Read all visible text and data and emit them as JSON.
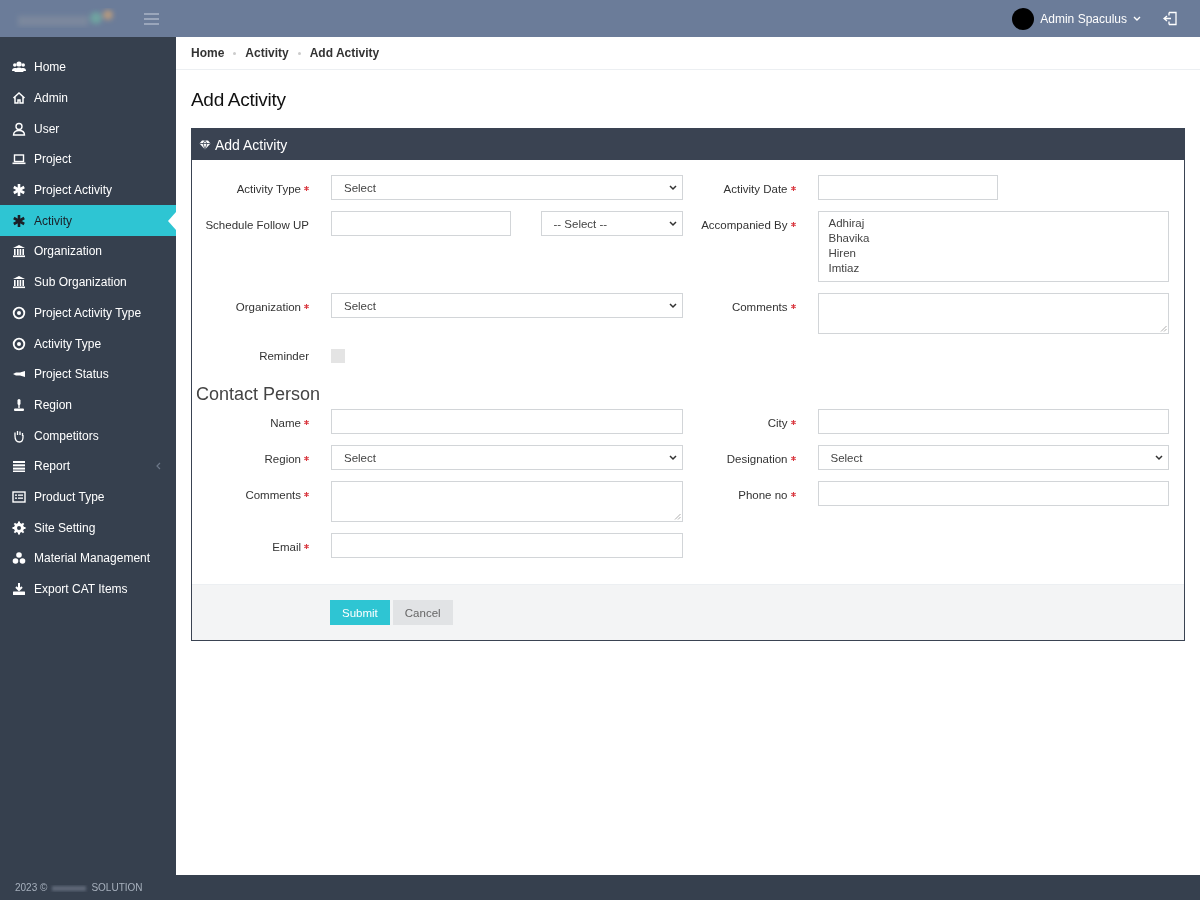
{
  "header": {
    "user_name": "Admin Spaculus"
  },
  "sidebar": {
    "items": [
      {
        "kind": "users",
        "label": "Home",
        "selected": false,
        "submenu": false
      },
      {
        "kind": "home",
        "label": "Admin",
        "selected": false,
        "submenu": false
      },
      {
        "kind": "user",
        "label": "User",
        "selected": false,
        "submenu": false
      },
      {
        "kind": "laptop",
        "label": "Project",
        "selected": false,
        "submenu": false
      },
      {
        "kind": "asterisk",
        "label": "Project Activity",
        "selected": false,
        "submenu": false
      },
      {
        "kind": "asterisk",
        "label": "Activity",
        "selected": true,
        "submenu": false
      },
      {
        "kind": "bank",
        "label": "Organization",
        "selected": false,
        "submenu": false
      },
      {
        "kind": "bank",
        "label": "Sub Organization",
        "selected": false,
        "submenu": false
      },
      {
        "kind": "target",
        "label": "Project Activity Type",
        "selected": false,
        "submenu": false
      },
      {
        "kind": "target",
        "label": "Activity Type",
        "selected": false,
        "submenu": false
      },
      {
        "kind": "plane",
        "label": "Project Status",
        "selected": false,
        "submenu": false
      },
      {
        "kind": "pin",
        "label": "Region",
        "selected": false,
        "submenu": false
      },
      {
        "kind": "hand",
        "label": "Competitors",
        "selected": false,
        "submenu": false
      },
      {
        "kind": "list",
        "label": "Report",
        "selected": false,
        "submenu": true
      },
      {
        "kind": "listalt",
        "label": "Product Type",
        "selected": false,
        "submenu": false
      },
      {
        "kind": "gear",
        "label": "Site Setting",
        "selected": false,
        "submenu": false
      },
      {
        "kind": "cubes",
        "label": "Material Management",
        "selected": false,
        "submenu": false
      },
      {
        "kind": "download",
        "label": "Export CAT Items",
        "selected": false,
        "submenu": false
      }
    ]
  },
  "breadcrumb": [
    "Home",
    "Activity",
    "Add Activity"
  ],
  "page_title": "Add Activity",
  "panel": {
    "title": "Add Activity",
    "sections": [
      {
        "rows": [
          {
            "left": {
              "kind": "select",
              "label": "Activity Type",
              "required": true,
              "value": "Select"
            },
            "right": {
              "kind": "date",
              "label": "Activity Date",
              "required": true
            }
          },
          {
            "left": {
              "kind": "text_select",
              "label": "Schedule Follow UP",
              "required": false,
              "value": "-- Select --"
            },
            "right": {
              "kind": "listbox",
              "label": "Accompanied By",
              "required": true,
              "options": [
                "Adhiraj",
                "Bhavika",
                "Hiren",
                "Imtiaz"
              ]
            }
          },
          {
            "left": {
              "kind": "select",
              "label": "Organization",
              "required": true,
              "value": "Select"
            },
            "right": {
              "kind": "textarea",
              "label": "Comments",
              "required": true
            }
          },
          {
            "left": {
              "kind": "checkbox",
              "label": "Reminder",
              "required": false,
              "checked": false
            }
          }
        ]
      },
      {
        "title": "Contact Person",
        "rows": [
          {
            "left": {
              "kind": "text",
              "label": "Name",
              "required": true
            },
            "right": {
              "kind": "text",
              "label": "City",
              "required": true
            }
          },
          {
            "left": {
              "kind": "select",
              "label": "Region",
              "required": true,
              "value": "Select"
            },
            "right": {
              "kind": "select",
              "label": "Designation",
              "required": true,
              "value": "Select"
            }
          },
          {
            "left": {
              "kind": "textarea",
              "label": "Comments",
              "required": true
            },
            "right": {
              "kind": "text",
              "label": "Phone no",
              "required": true
            }
          },
          {
            "left": {
              "kind": "text",
              "label": "Email",
              "required": true
            }
          }
        ]
      }
    ],
    "buttons": [
      {
        "kind": "primary",
        "label": "Submit"
      },
      {
        "kind": "secondary",
        "label": "Cancel"
      }
    ]
  },
  "footer": {
    "year": "2023 ©",
    "company": "SOLUTION"
  }
}
